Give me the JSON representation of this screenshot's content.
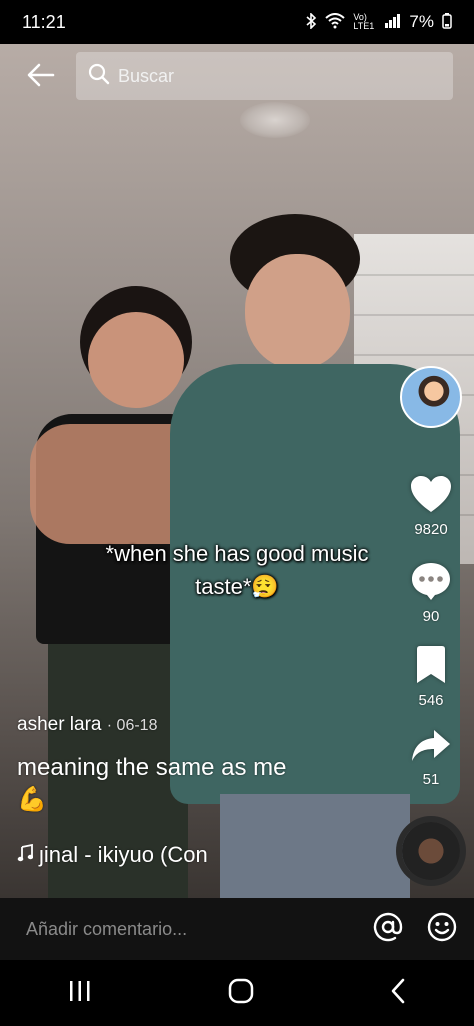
{
  "status_bar": {
    "time": "11:21",
    "network": "Vo) LTE1",
    "battery": "7%"
  },
  "search": {
    "placeholder": "Buscar"
  },
  "video": {
    "overlay_caption_line1": "*when she has good music",
    "overlay_caption_line2": "taste*😮‍💨"
  },
  "rail": {
    "likes": "9820",
    "comments": "90",
    "saves": "546",
    "shares": "51"
  },
  "post": {
    "author": "asher lara",
    "date": "· 06-18",
    "description": "meaning the same as me",
    "description_emoji": "💪",
    "music": "ȷinal - ikiyuo (Con"
  },
  "comment_bar": {
    "placeholder": "Añadir comentario..."
  },
  "icons": {
    "back": "back-arrow-icon",
    "search": "search-icon",
    "like": "heart-icon",
    "comment": "comment-icon",
    "save": "bookmark-icon",
    "share": "share-icon",
    "mention": "at-icon",
    "emoji": "emoji-icon"
  },
  "colors": {
    "background": "#000000",
    "comment_bar": "#121212",
    "text": "#ffffff",
    "placeholder_text": "#8a8a8a"
  }
}
